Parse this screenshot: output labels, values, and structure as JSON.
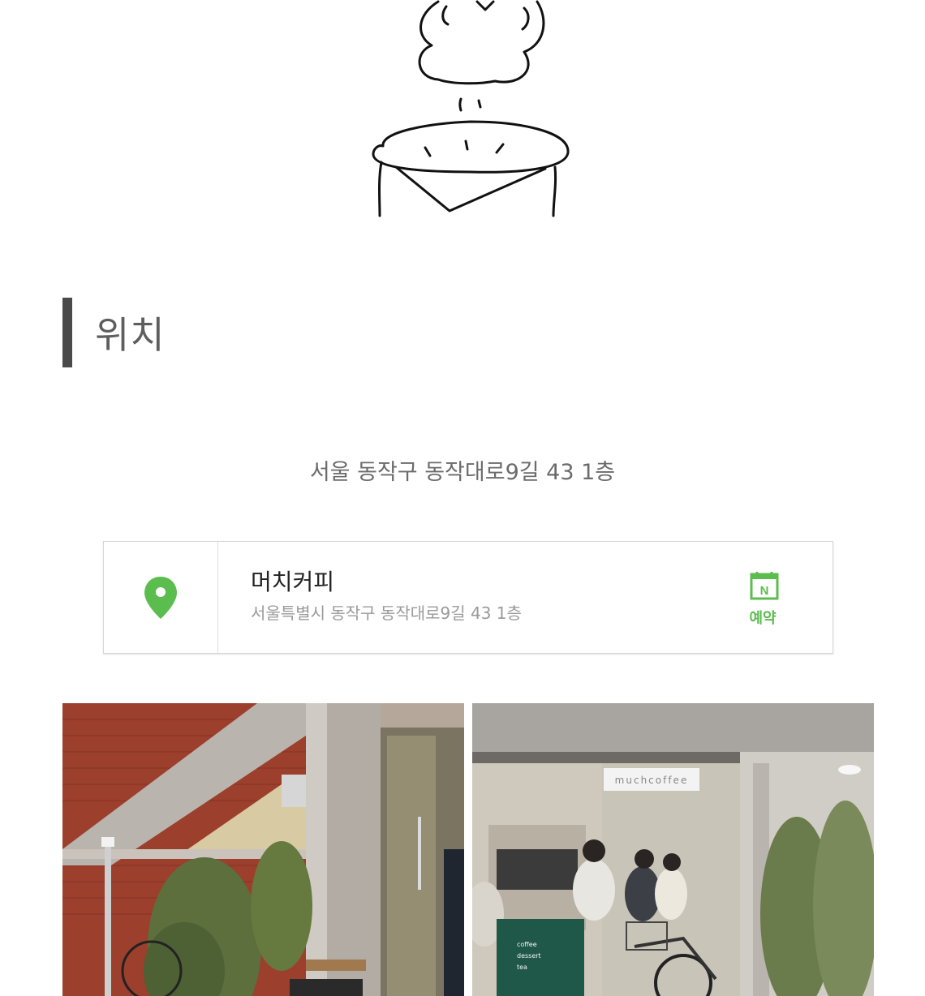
{
  "section": {
    "title": "위치"
  },
  "address_line": "서울 동작구 동작대로9길 43 1층",
  "place_card": {
    "name": "머치커피",
    "address": "서울특별시 동작구 동작대로9길 43 1층",
    "reserve_label": "예약",
    "reserve_icon_letter": "N",
    "pin_icon": "map-pin-icon",
    "accent_color": "#5cbd4f"
  },
  "photos": {
    "right_sign": "muchcoffee",
    "board_lines": [
      "coffee",
      "dessert",
      "tea"
    ]
  }
}
